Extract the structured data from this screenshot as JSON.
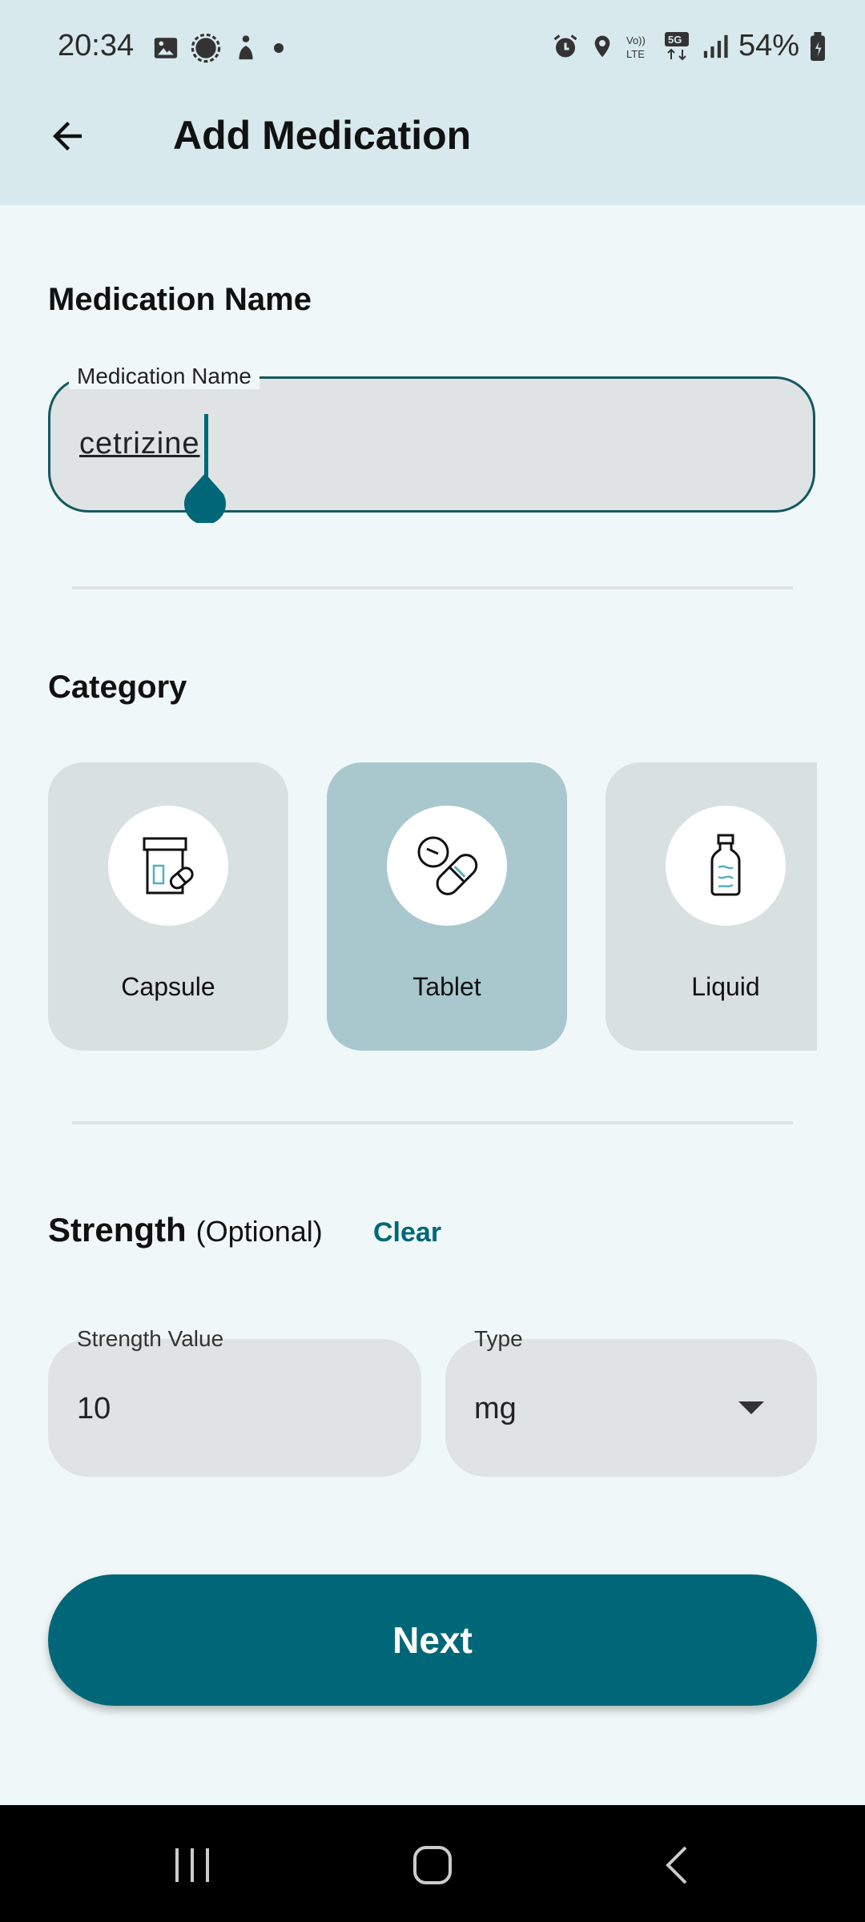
{
  "status_bar": {
    "time": "20:34",
    "battery": "54%",
    "icons": [
      "gallery-icon",
      "brightness-icon",
      "accessibility-icon",
      "dot-icon",
      "alarm-icon",
      "location-icon",
      "volte-icon",
      "5g-icon",
      "signal-icon",
      "battery-icon"
    ]
  },
  "header": {
    "title": "Add Medication",
    "back_icon": "arrow-left-icon"
  },
  "medication_name": {
    "section_title": "Medication Name",
    "field_label": "Medication Name",
    "value": "cetrizine"
  },
  "category": {
    "section_title": "Category",
    "items": [
      {
        "label": "Capsule",
        "icon": "pill-bottle-icon",
        "selected": false
      },
      {
        "label": "Tablet",
        "icon": "tablet-capsule-icon",
        "selected": true
      },
      {
        "label": "Liquid",
        "icon": "liquid-bottle-icon",
        "selected": false
      }
    ]
  },
  "strength": {
    "section_title": "Strength",
    "optional_text": "(Optional)",
    "clear_label": "Clear",
    "value_label": "Strength Value",
    "value": "10",
    "type_label": "Type",
    "type_value": "mg"
  },
  "actions": {
    "next_label": "Next"
  },
  "colors": {
    "accent": "#006778",
    "header_bg": "#d7e9ec",
    "page_bg": "#f0f7f8",
    "selected_card": "#a9c8cd",
    "card": "#d9e0e0",
    "field_bg": "#dfe3e4"
  }
}
